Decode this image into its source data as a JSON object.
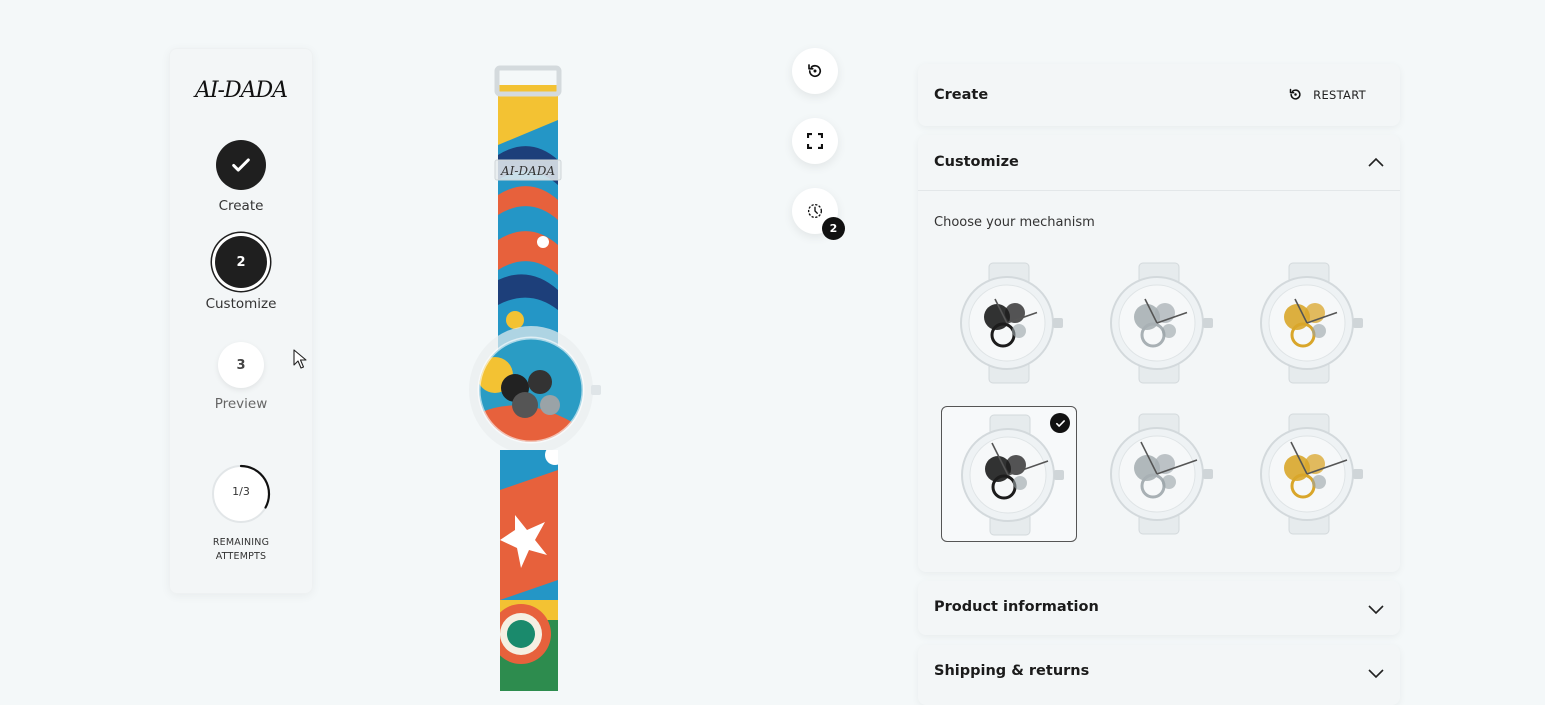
{
  "brand": {
    "logo_text": "AI-DADA"
  },
  "stepper": {
    "steps": [
      {
        "number": "",
        "label": "Create",
        "state": "done"
      },
      {
        "number": "2",
        "label": "Customize",
        "state": "active"
      },
      {
        "number": "3",
        "label": "Preview",
        "state": "pending"
      }
    ],
    "attempts": {
      "value": "1/3",
      "caption_line1": "REMAINING",
      "caption_line2": "ATTEMPTS",
      "progress_fraction": 0.33
    }
  },
  "tools": {
    "restart_icon": "restart-icon",
    "fullscreen_icon": "fullscreen-icon",
    "history_icon": "history-icon",
    "history_count": "2"
  },
  "panels": {
    "create": {
      "title": "Create",
      "restart_label": "RESTART"
    },
    "customize": {
      "title": "Customize",
      "prompt": "Choose your mechanism",
      "options": [
        {
          "gear": "black",
          "hands": "short",
          "selected": false
        },
        {
          "gear": "silver",
          "hands": "short",
          "selected": false
        },
        {
          "gear": "gold",
          "hands": "short",
          "selected": false
        },
        {
          "gear": "black",
          "hands": "long",
          "selected": true
        },
        {
          "gear": "silver",
          "hands": "long",
          "selected": false
        },
        {
          "gear": "gold",
          "hands": "long",
          "selected": false
        }
      ]
    },
    "product_info": {
      "title": "Product information"
    },
    "shipping": {
      "title": "Shipping & returns"
    }
  },
  "colors": {
    "accent": "#1f1f1f",
    "background": "#f4f8f9",
    "panel": "#f3f6f7",
    "gold": "#d9a62a"
  }
}
